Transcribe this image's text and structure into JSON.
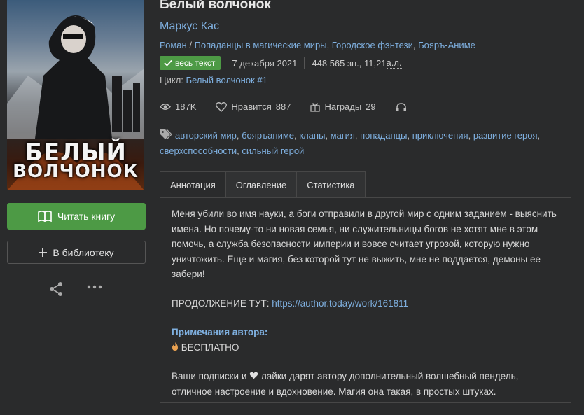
{
  "cover": {
    "title_line1": "БЕЛЫЙ",
    "title_line2": "ВОЛЧОНОК"
  },
  "actions": {
    "read_label": "Читать книгу",
    "library_label": "В библиотеку",
    "share_icon": "share-icon",
    "more_icon": "more-icon"
  },
  "book": {
    "title": "Белый волчонок",
    "author": "Маркус Кас",
    "genre_type": "Роман",
    "genre_sep": "/",
    "genres": [
      "Попаданцы в магические миры",
      "Городское фэнтези",
      "Бояръ-Аниме"
    ],
    "badge": "весь текст",
    "date": "7 декабря 2021",
    "size": "448 565 зн., 11,21 ",
    "size_unit": "а.л.",
    "cycle_label": "Цикл:",
    "cycle_value": "Белый волчонок #1"
  },
  "stats": {
    "views": "187K",
    "likes_label": "Нравится",
    "likes": "887",
    "awards_label": "Награды",
    "awards": "29"
  },
  "tags": [
    "авторский мир",
    "бояръаниме",
    "кланы",
    "магия",
    "попаданцы",
    "приключения",
    "развитие героя",
    "сверхспособности",
    "сильный герой"
  ],
  "tabs": [
    "Аннотация",
    "Оглавление",
    "Статистика"
  ],
  "annotation": {
    "text": "Меня убили во имя науки, а боги отправили в другой мир с одним заданием - выяснить имена. Но почему-то ни новая семья, ни служительницы богов не хотят мне в этом помочь, а служба безопасности империи и вовсе считает угрозой, которую нужно уничтожить. Еще и магия, без которой тут не выжить, мне не поддается, демоны ее забери!",
    "continuation_label": "ПРОДОЛЖЕНИЕ ТУТ:",
    "continuation_link": "https://author.today/work/161811",
    "notes_heading": "Примечания автора:",
    "free_text": "БЕСПЛАТНО",
    "subs_before": "Ваши подписки и",
    "subs_after": "лайки дарят автору дополнительный волшебный пендель, отличное настроение и вдохновение. Магия она такая, в простых штуках."
  },
  "colors": {
    "accent_green": "#4d9a45",
    "link_blue": "#7fb0e0",
    "background": "#2a2b2c"
  }
}
